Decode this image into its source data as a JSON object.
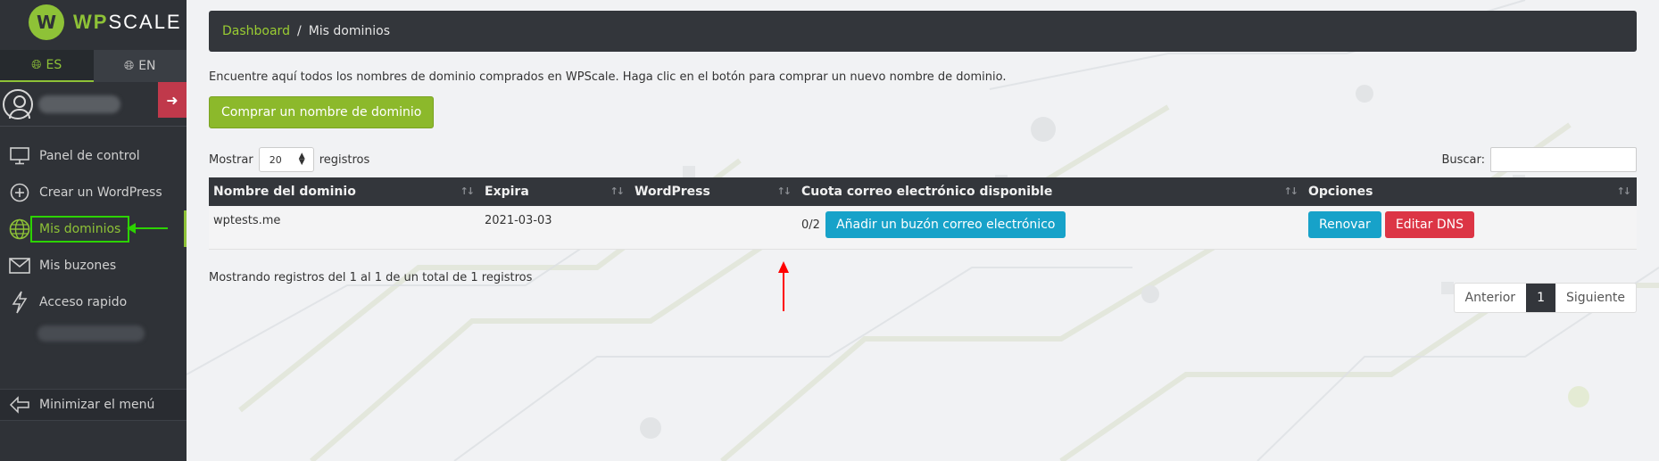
{
  "brand": {
    "name_prefix": "WP",
    "name_suffix": "SCALE",
    "logo_glyph": "W",
    "accent": "#8ec237"
  },
  "languages": [
    {
      "code": "ES",
      "active": true
    },
    {
      "code": "EN",
      "active": false
    }
  ],
  "sidebar": {
    "items": [
      {
        "label": "Panel de control",
        "icon": "monitor-icon"
      },
      {
        "label": "Crear un WordPress",
        "icon": "plus-circle-icon"
      },
      {
        "label": "Mis dominios",
        "icon": "globe-icon",
        "active": true
      },
      {
        "label": "Mis buzones",
        "icon": "mail-icon"
      },
      {
        "label": "Acceso rapido",
        "icon": "bolt-icon"
      }
    ],
    "minimize_label": "Minimizar el menú"
  },
  "breadcrumb": {
    "home": "Dashboard",
    "separator": "/",
    "current": "Mis dominios"
  },
  "intro_text": "Encuentre aquí todos los nombres de dominio comprados en WPScale. Haga clic en el botón para comprar un nuevo nombre de dominio.",
  "buy_button_label": "Comprar un nombre de dominio",
  "controls": {
    "show_label": "Mostrar",
    "show_value": "20",
    "records_label": "registros",
    "search_label": "Buscar:",
    "search_value": ""
  },
  "table": {
    "columns": [
      "Nombre del dominio",
      "Expira",
      "WordPress",
      "Cuota correo electrónico disponible",
      "Opciones"
    ],
    "rows": [
      {
        "domain": "wptests.me",
        "expires": "2021-03-03",
        "wordpress": "",
        "quota": "0/2",
        "add_mailbox_label": "Añadir un buzón correo electrónico",
        "renew_label": "Renovar",
        "edit_dns_label": "Editar DNS"
      }
    ]
  },
  "footer": {
    "info": "Mostrando registros del 1 al 1 de un total de 1 registros",
    "prev_label": "Anterior",
    "current_page": "1",
    "next_label": "Siguiente"
  },
  "colors": {
    "sidebar_bg": "#2f3237",
    "primary_green": "#8cb92b",
    "info_blue": "#17a2c9",
    "danger_red": "#dc3545",
    "annotation_green": "#2cd300",
    "annotation_red": "#ff0000"
  }
}
